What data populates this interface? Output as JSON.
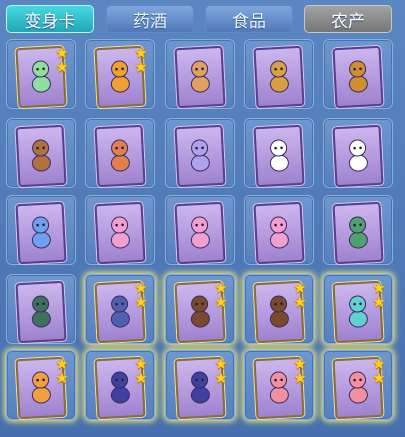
{
  "tabs": [
    {
      "label": "变身卡",
      "state": "active"
    },
    {
      "label": "药酒",
      "state": "normal"
    },
    {
      "label": "食品",
      "state": "normal"
    },
    {
      "label": "农产",
      "state": "dark"
    }
  ],
  "colors": {
    "accent": "#22a8b8",
    "star": "#ffd21c",
    "panel": "#4a73b0"
  },
  "items": [
    {
      "name": "transform-card-1",
      "stars": 2,
      "glow": false,
      "figure": "#8fe0a0"
    },
    {
      "name": "transform-card-2",
      "stars": 2,
      "glow": false,
      "figure": "#f0a030"
    },
    {
      "name": "transform-card-3",
      "stars": 0,
      "glow": false,
      "figure": "#e0a060"
    },
    {
      "name": "transform-card-4",
      "stars": 0,
      "glow": false,
      "figure": "#d8a040"
    },
    {
      "name": "transform-card-5",
      "stars": 0,
      "glow": false,
      "figure": "#d09030"
    },
    {
      "name": "transform-card-6",
      "stars": 0,
      "glow": false,
      "figure": "#b07040"
    },
    {
      "name": "transform-card-7",
      "stars": 0,
      "glow": false,
      "figure": "#e08050"
    },
    {
      "name": "transform-card-8",
      "stars": 0,
      "glow": false,
      "figure": "#b0a0f0"
    },
    {
      "name": "transform-card-9",
      "stars": 0,
      "glow": false,
      "figure": "#ffffff"
    },
    {
      "name": "transform-card-10",
      "stars": 0,
      "glow": false,
      "figure": "#ffffff"
    },
    {
      "name": "transform-card-11",
      "stars": 0,
      "glow": false,
      "figure": "#6fa0f0"
    },
    {
      "name": "transform-card-12",
      "stars": 0,
      "glow": false,
      "figure": "#f0a0d0"
    },
    {
      "name": "transform-card-13",
      "stars": 0,
      "glow": false,
      "figure": "#f0a0d0"
    },
    {
      "name": "transform-card-14",
      "stars": 0,
      "glow": false,
      "figure": "#f0a0d0"
    },
    {
      "name": "transform-card-15",
      "stars": 0,
      "glow": false,
      "figure": "#50a070"
    },
    {
      "name": "transform-card-16",
      "stars": 0,
      "glow": false,
      "figure": "#407060"
    },
    {
      "name": "transform-card-17",
      "stars": 2,
      "glow": true,
      "figure": "#5060b0"
    },
    {
      "name": "transform-card-18",
      "stars": 2,
      "glow": true,
      "figure": "#7a4a30"
    },
    {
      "name": "transform-card-19",
      "stars": 2,
      "glow": true,
      "figure": "#7a4a30"
    },
    {
      "name": "transform-card-20",
      "stars": 2,
      "glow": true,
      "figure": "#60d0d0"
    },
    {
      "name": "transform-card-21",
      "stars": 2,
      "glow": true,
      "figure": "#f0a040"
    },
    {
      "name": "transform-card-22",
      "stars": 2,
      "glow": true,
      "figure": "#4040a0"
    },
    {
      "name": "transform-card-23",
      "stars": 2,
      "glow": true,
      "figure": "#4040a0"
    },
    {
      "name": "transform-card-24",
      "stars": 2,
      "glow": true,
      "figure": "#f090a0"
    },
    {
      "name": "transform-card-25",
      "stars": 2,
      "glow": true,
      "figure": "#f090a0"
    }
  ]
}
